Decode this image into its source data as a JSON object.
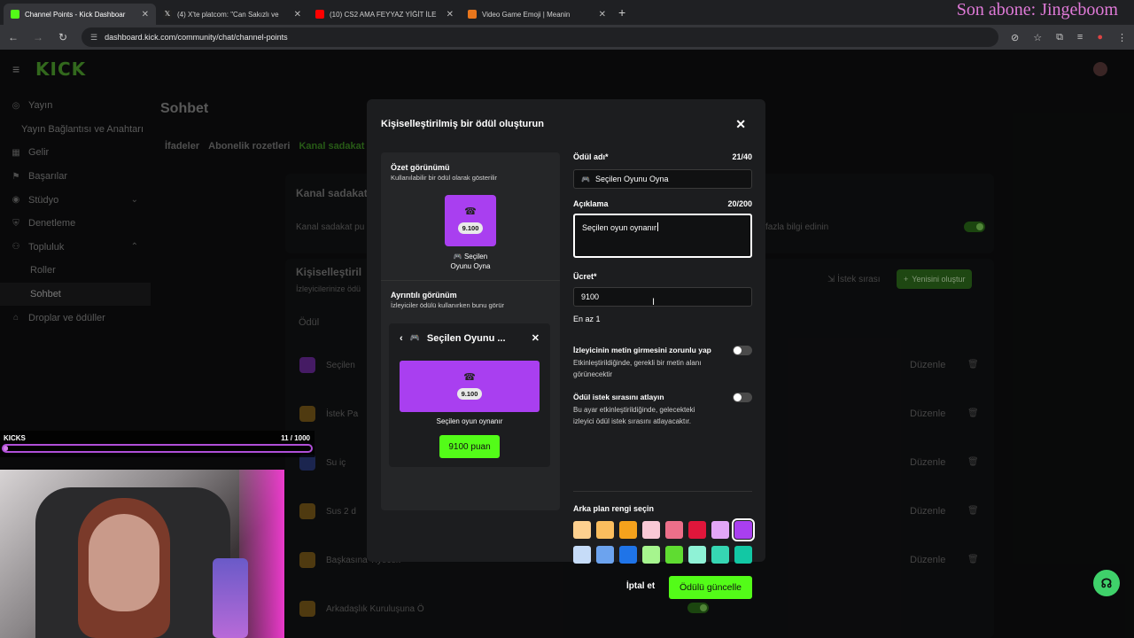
{
  "browser": {
    "tabs": [
      {
        "title": "Channel Points - Kick Dashboar",
        "favicon_color": "#53fc18",
        "active": true
      },
      {
        "title": "(4) X'te platcom: \"Can Sakızlı ve",
        "favicon_color": "#ffffff",
        "active": false
      },
      {
        "title": "(10) CS2 AMA FEYYAZ YİĞİT İLE",
        "favicon_color": "#ff0000",
        "active": false
      },
      {
        "title": "Video Game Emoji | Meanin",
        "favicon_color": "#e8761c",
        "active": false
      }
    ],
    "new_tab": "+",
    "url": "dashboard.kick.com/community/chat/channel-points",
    "icons": [
      "back-icon",
      "forward-icon",
      "reload-icon",
      "site-info-icon",
      "eye-off-icon",
      "star-icon",
      "extensions-icon",
      "media-icon",
      "profile-icon",
      "menu-icon"
    ]
  },
  "stream_overlay": {
    "title": "Son abone: Jingeboom",
    "kicks": {
      "label": "KICKS",
      "count": "11 / 1000",
      "progress": 0.011
    }
  },
  "kick": {
    "logo": "KICK",
    "sidebar": [
      {
        "label": "Yayın",
        "icon": "broadcast-icon",
        "type": "item"
      },
      {
        "label": "Yayın Bağlantısı ve Anahtarı",
        "type": "indent"
      },
      {
        "label": "Gelir",
        "icon": "revenue-icon",
        "type": "item"
      },
      {
        "label": "Başarılar",
        "icon": "achievements-icon",
        "type": "item"
      },
      {
        "label": "Stüdyo",
        "icon": "studio-icon",
        "type": "item",
        "chevron": "down"
      },
      {
        "label": "Denetleme",
        "icon": "moderation-icon",
        "type": "item"
      },
      {
        "label": "Topluluk",
        "icon": "community-icon",
        "type": "item",
        "chevron": "up"
      },
      {
        "label": "Roller",
        "type": "sub"
      },
      {
        "label": "Sohbet",
        "type": "sub",
        "active": true
      },
      {
        "label": "Droplar ve ödüller",
        "icon": "drops-icon",
        "type": "item"
      }
    ],
    "page_title": "Sohbet",
    "tabs": [
      "İfadeler",
      "Abonelik rozetleri",
      "Kanal sadakat p"
    ],
    "background": {
      "section_title": "Kanal sadakat",
      "section_desc": "Kanal sadakat pu",
      "more_info": "fazla bilgi edinin",
      "custom_title": "Kişiselleştiril",
      "custom_desc": "İzleyicilerinize ödü",
      "column_reward": "Ödül",
      "queue_label": "İstek sırası",
      "create_new": "Yenisini oluştur",
      "rows": [
        {
          "name": "Seçilen",
          "color": "#a93ff0"
        },
        {
          "name": "İstek Pa",
          "color": "#e8a21c"
        },
        {
          "name": "Su iç",
          "color": "#3a7de8"
        },
        {
          "name": "Sus 2 d",
          "color": "#e8a21c"
        },
        {
          "name": "Başkasına Yiyecek",
          "color": "#e8a21c"
        },
        {
          "name": "Arkadaşlık Kuruluşuna Ö",
          "color": "#e8a21c"
        }
      ],
      "edit_label": "Düzenle"
    }
  },
  "modal": {
    "title": "Kişiselleştirilmiş bir ödül oluşturun",
    "summary": {
      "heading": "Özet görünümü",
      "subtitle": "Kullanılabilir bir ödül olarak gösterilir",
      "points": "9.100",
      "caption_line1": "🎮 Seçilen",
      "caption_line2": "Oyunu Oyna"
    },
    "detail": {
      "heading": "Ayrıntılı görünüm",
      "subtitle": "İzleyiciler ödülü kullanırken bunu görür",
      "title": "Seçilen Oyunu ...",
      "points": "9.100",
      "description": "Seçilen oyun oynanır",
      "button": "9100 puan"
    },
    "form": {
      "name_label": "Ödül adı*",
      "name_count": "21/40",
      "name_value": "Seçilen Oyunu Oyna",
      "desc_label": "Açıklama",
      "desc_count": "20/200",
      "desc_value": "Seçilen oyun oynanır",
      "cost_label": "Ücret*",
      "cost_value": "9100",
      "cost_hint": "En az 1",
      "toggle1_title": "İzleyicinin metin girmesini zorunlu yap",
      "toggle1_desc_1": "Etkinleştirildiğinde, gerekli bir metin alanı",
      "toggle1_desc_2": "görünecektir",
      "toggle1_on": false,
      "toggle2_title": "Ödül istek sırasını atlayın",
      "toggle2_desc_1": "Bu ayar etkinleştirildiğinde, gelecekteki",
      "toggle2_desc_2": "izleyici ödül istek sırasını atlayacaktır.",
      "toggle2_on": false,
      "color_label": "Arka plan rengi seçin",
      "colors": [
        "#fdd08f",
        "#fbbe5e",
        "#f5a21c",
        "#f9c9d6",
        "#ec6f8a",
        "#e0163b",
        "#e2a6f7",
        "#a93ff0",
        "#c6dcf8",
        "#6ca3ee",
        "#1f74e8",
        "#a6f58e",
        "#5fdc31",
        "#8ff2d6",
        "#36d6b3",
        "#12c8a4"
      ],
      "selected_color": "#a93ff0",
      "cancel": "İptal et",
      "submit": "Ödülü güncelle"
    }
  }
}
